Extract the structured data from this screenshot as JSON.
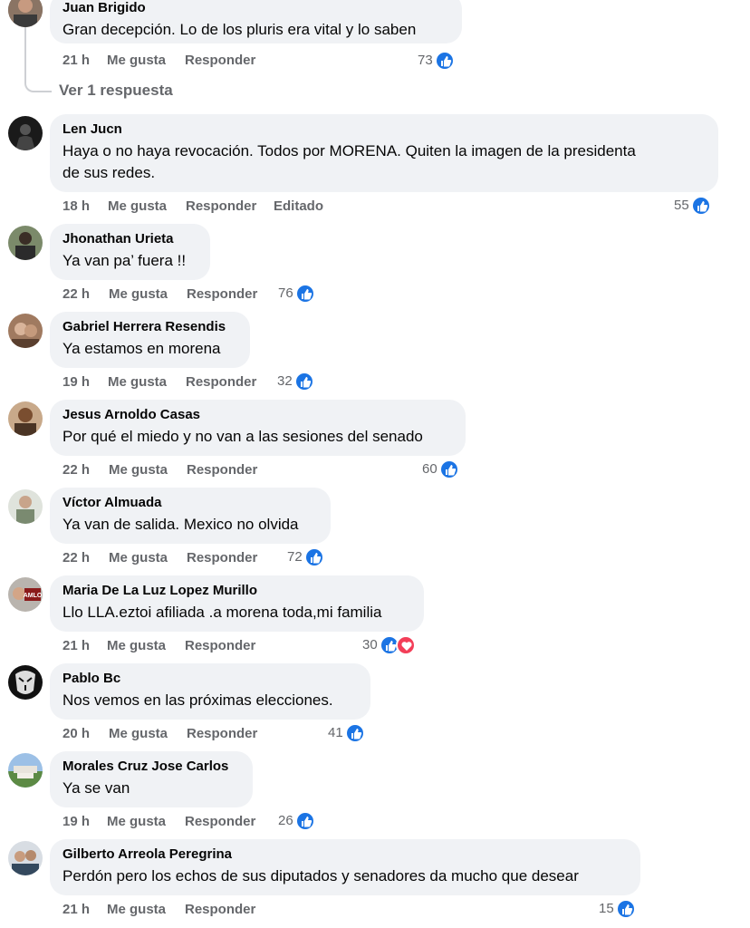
{
  "actions": {
    "like": "Me gusta",
    "reply": "Responder",
    "edited": "Editado"
  },
  "replies_link": "Ver 1 respuesta",
  "comments": [
    {
      "author": "Juan Brigido",
      "lines": [
        "Gran decepción. Lo de los pluris era vital y lo saben"
      ],
      "time": "21 h",
      "likes": "73",
      "edited": false,
      "reactions": [
        "like"
      ]
    },
    {
      "author": "Len Jucn",
      "lines": [
        "Haya o no haya revocación. Todos por MORENA. Quiten la imagen de la presidenta",
        "de sus redes."
      ],
      "time": "18 h",
      "likes": "55",
      "edited": true,
      "reactions": [
        "like"
      ]
    },
    {
      "author": "Jhonathan Urieta",
      "lines": [
        "Ya van pa’ fuera !!"
      ],
      "time": "22 h",
      "likes": "76",
      "edited": false,
      "reactions": [
        "like"
      ]
    },
    {
      "author": "Gabriel Herrera Resendis",
      "lines": [
        "Ya estamos en morena"
      ],
      "time": "19 h",
      "likes": "32",
      "edited": false,
      "reactions": [
        "like"
      ]
    },
    {
      "author": "Jesus Arnoldo Casas",
      "lines": [
        "Por qué el miedo y no van a las sesiones del senado"
      ],
      "time": "22 h",
      "likes": "60",
      "edited": false,
      "reactions": [
        "like"
      ]
    },
    {
      "author": "Víctor Almuada",
      "lines": [
        "Ya van de salida. Mexico no olvida"
      ],
      "time": "22 h",
      "likes": "72",
      "edited": false,
      "reactions": [
        "like"
      ]
    },
    {
      "author": "Maria De La Luz Lopez Murillo",
      "lines": [
        "Llo LLA.eztoi afiliada .a morena toda,mi familia"
      ],
      "time": "21 h",
      "likes": "30",
      "edited": false,
      "reactions": [
        "like",
        "love"
      ],
      "avatar_text": "AMLO"
    },
    {
      "author": "Pablo Bc",
      "lines": [
        "Nos vemos en las próximas elecciones."
      ],
      "time": "20 h",
      "likes": "41",
      "edited": false,
      "reactions": [
        "like"
      ]
    },
    {
      "author": "Morales Cruz Jose Carlos",
      "lines": [
        "Ya se van"
      ],
      "time": "19 h",
      "likes": "26",
      "edited": false,
      "reactions": [
        "like"
      ]
    },
    {
      "author": "Gilberto Arreola Peregrina",
      "lines": [
        "Perdón pero los echos de sus diputados y senadores da mucho que desear"
      ],
      "time": "21 h",
      "likes": "15",
      "edited": false,
      "reactions": [
        "like"
      ]
    }
  ],
  "colors": {
    "bubble": "#f0f2f5",
    "meta": "#65676b",
    "like": "#1b74e4",
    "love": "#f33e58"
  }
}
